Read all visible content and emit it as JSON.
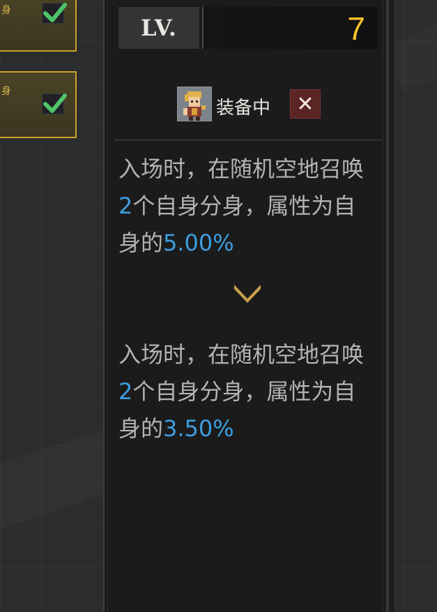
{
  "left_cards": [
    {
      "fragment": "身",
      "checked": true
    },
    {
      "fragment": "身",
      "checked": true
    }
  ],
  "level": {
    "label": "LV.",
    "value": "7"
  },
  "equip": {
    "status_label": "装备中",
    "close_label": "✕"
  },
  "descriptions": {
    "current": {
      "pre": "入场时，在随机空地召唤",
      "count": "2",
      "mid": "个自身分身，属性为自身的",
      "percent": "5.00%"
    },
    "next": {
      "pre": "入场时，在随机空地召唤",
      "count": "2",
      "mid": "个自身分身，属性为自身的",
      "percent": "3.50%"
    }
  },
  "colors": {
    "accent_gold": "#f4c12b",
    "highlight_blue": "#3d9ee0",
    "card_border": "#c9a42a",
    "check_green": "#4fc46a"
  },
  "icons": {
    "check": "check-icon",
    "chevron": "chevron-down-icon",
    "close": "close-icon"
  }
}
